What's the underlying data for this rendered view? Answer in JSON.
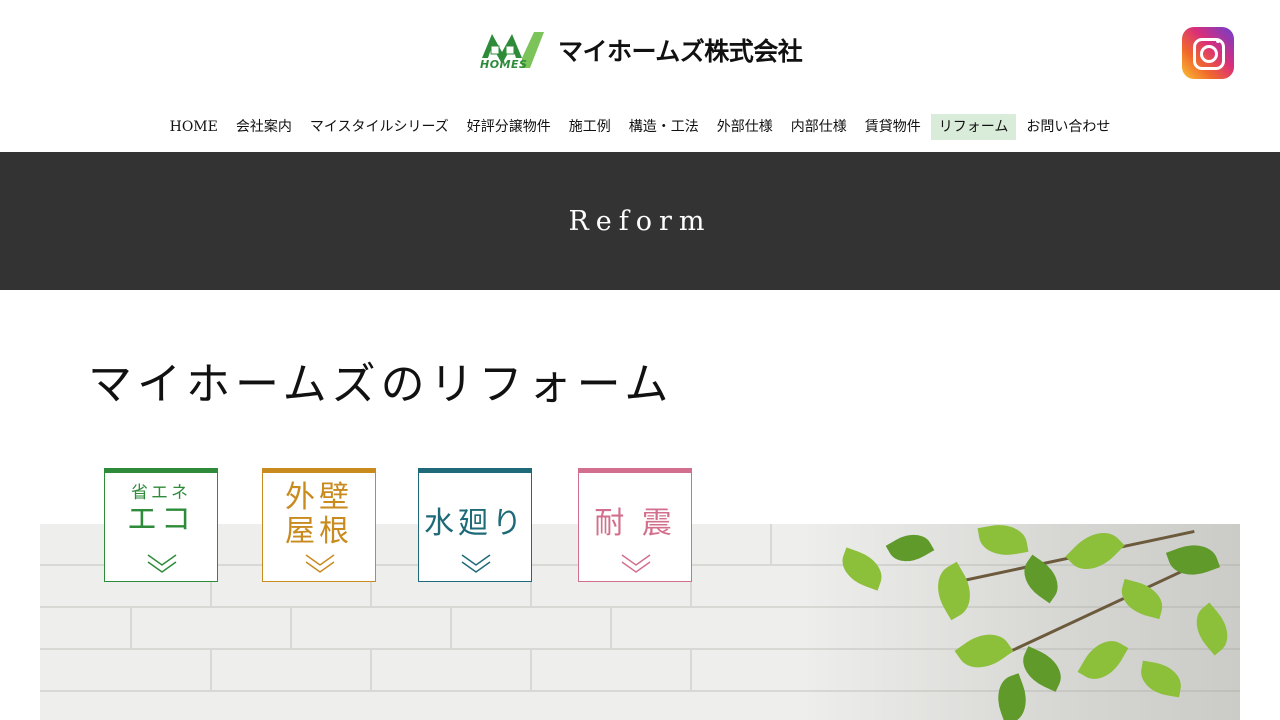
{
  "header": {
    "logo_mark_text": "HOMES",
    "logo_text": "マイホームズ株式会社",
    "instagram_icon": "instagram-icon"
  },
  "nav": {
    "items": [
      {
        "label": "HOME"
      },
      {
        "label": "会社案内"
      },
      {
        "label": "マイスタイルシリーズ"
      },
      {
        "label": "好評分譲物件"
      },
      {
        "label": "施工例"
      },
      {
        "label": "構造・工法"
      },
      {
        "label": "外部仕様"
      },
      {
        "label": "内部仕様"
      },
      {
        "label": "賃貸物件"
      },
      {
        "label": "リフォーム",
        "active": true
      },
      {
        "label": "お問い合わせ"
      }
    ]
  },
  "banner": {
    "title": "Reform"
  },
  "main": {
    "heading": "マイホームズのリフォーム"
  },
  "categories": [
    {
      "small": "省エネ",
      "big": "エコ",
      "color": "#2e8b3a"
    },
    {
      "line1": "外壁",
      "line2": "屋根",
      "color": "#c98a1e"
    },
    {
      "big": "水廻り",
      "color": "#1e6a78"
    },
    {
      "big": "耐 震",
      "color": "#d36f8e"
    }
  ],
  "colors": {
    "banner_bg": "#333333",
    "nav_active_bg": "#d9ecd9"
  }
}
